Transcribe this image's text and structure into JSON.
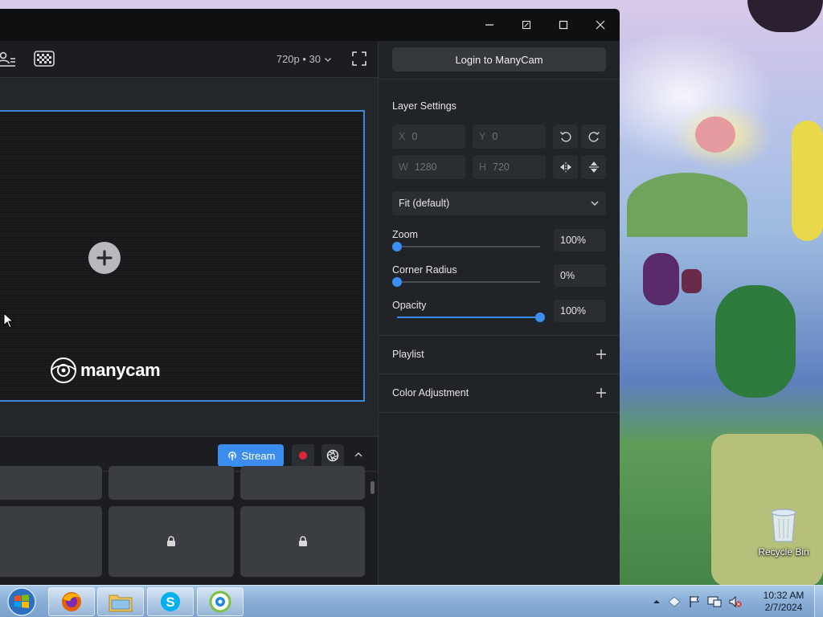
{
  "app": {
    "resolution_label": "720p • 30",
    "logo_text": "manycam",
    "stream_label": "Stream",
    "accent_color": "#3b8ef0",
    "record_color": "#e0253a"
  },
  "right_panel": {
    "login_label": "Login to ManyCam",
    "layer_settings_title": "Layer Settings",
    "x": {
      "label": "X",
      "value": "0"
    },
    "y": {
      "label": "Y",
      "value": "0"
    },
    "w": {
      "label": "W",
      "value": "1280"
    },
    "h": {
      "label": "H",
      "value": "720"
    },
    "fit_mode": "Fit (default)",
    "zoom": {
      "label": "Zoom",
      "value": "100%",
      "level": 0.0
    },
    "corner_radius": {
      "label": "Corner Radius",
      "value": "0%",
      "level": 0.0
    },
    "opacity": {
      "label": "Opacity",
      "value": "100%",
      "level": 1.0
    },
    "playlist_title": "Playlist",
    "color_adjustment_title": "Color Adjustment"
  },
  "desktop": {
    "recycle_bin_label": "Recycle Bin"
  },
  "taskbar": {
    "apps": [
      "firefox-icon",
      "file-explorer-icon",
      "skype-icon",
      "manycam-icon"
    ],
    "clock_time": "10:32 AM",
    "clock_date": "2/7/2024"
  }
}
